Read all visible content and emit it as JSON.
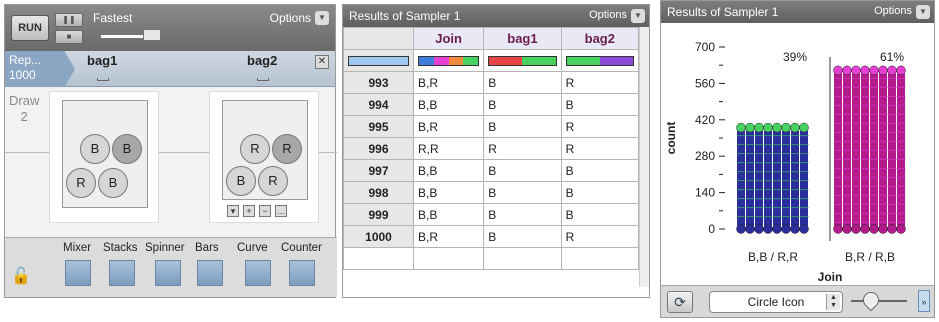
{
  "sampler": {
    "run_label": "RUN",
    "pause_icon": "pause-icon",
    "stop_icon": "stop-icon",
    "speed_label": "Fastest",
    "options_label": "Options",
    "rep_label": "Rep...",
    "rep_value": "1000",
    "draw_label": "Draw",
    "draw_value": "2",
    "bags": [
      {
        "name": "bag1",
        "balls": [
          "B",
          "B",
          "R",
          "B"
        ]
      },
      {
        "name": "bag2",
        "balls": [
          "R",
          "R",
          "B",
          "R"
        ]
      }
    ],
    "mini_buttons": [
      "▾",
      "+",
      "−",
      "…"
    ],
    "devices": [
      "Mixer",
      "Stacks",
      "Spinner",
      "Bars",
      "Curve",
      "Counter"
    ]
  },
  "table": {
    "title": "Results of Sampler 1",
    "options_label": "Options",
    "headers": [
      "Join",
      "bag1",
      "bag2"
    ],
    "swatches": [
      [
        "#3d7ddb",
        "#e53fd3",
        "#f08a3c",
        "#46d161"
      ],
      [
        "#e64545",
        "#46d161"
      ],
      [
        "#46d161",
        "#8a4ad8"
      ]
    ],
    "rows": [
      [
        "993",
        "B,R",
        "B",
        "R"
      ],
      [
        "994",
        "B,B",
        "B",
        "B"
      ],
      [
        "995",
        "B,R",
        "B",
        "R"
      ],
      [
        "996",
        "R,R",
        "R",
        "R"
      ],
      [
        "997",
        "B,B",
        "B",
        "B"
      ],
      [
        "998",
        "B,B",
        "B",
        "B"
      ],
      [
        "999",
        "B,B",
        "B",
        "B"
      ],
      [
        "1000",
        "B,R",
        "B",
        "R"
      ]
    ]
  },
  "graph": {
    "title": "Results of Sampler 1",
    "options_label": "Options",
    "icon_select": "Circle Icon",
    "refresh_icon": "refresh-icon",
    "more_icon": "double-chevron-right-icon"
  },
  "chart_data": {
    "type": "scatter",
    "ylabel": "count",
    "xlabel": "Join",
    "yticks": [
      0,
      140,
      280,
      420,
      560,
      700
    ],
    "ylim": [
      0,
      700
    ],
    "categories": [
      "B,B / R,R",
      "B,R / R,B"
    ],
    "percent_labels": [
      "39%",
      "61%"
    ],
    "values": [
      390,
      610
    ],
    "colors": [
      [
        "#2a2e9c",
        "#46d161"
      ],
      [
        "#b31a8c",
        "#e53fd3"
      ]
    ]
  }
}
